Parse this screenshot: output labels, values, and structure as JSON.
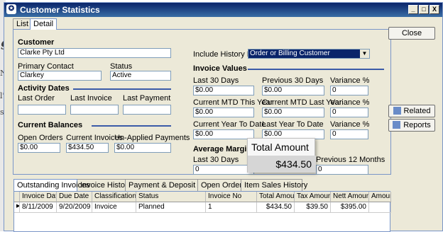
{
  "background": {
    "frag1": "g",
    "frag2": "Na",
    "frag3": "l's",
    "frag4": "sp"
  },
  "window": {
    "title": "Customer Statistics",
    "min": "_",
    "max": "□",
    "close": "X"
  },
  "tabs": [
    "List",
    "Detail"
  ],
  "customer": {
    "heading": "Customer",
    "name": "Clarke Pty Ltd",
    "primary_contact_label": "Primary Contact",
    "primary_contact": "Clarkey",
    "status_label": "Status",
    "status": "Active"
  },
  "history": {
    "label": "Include History For",
    "value": "Order or Billing Customer"
  },
  "activity": {
    "heading": "Activity Dates",
    "last_order": "Last Order",
    "last_invoice": "Last Invoice",
    "last_payment": "Last Payment"
  },
  "balances": {
    "heading": "Current Balances",
    "open_orders_label": "Open Orders",
    "open_orders": "$0.00",
    "current_invoices_label": "Current Invoices",
    "current_invoices": "$434.50",
    "unapplied_label": "Un-Applied Payments",
    "unapplied": "$0.00"
  },
  "invoice_values": {
    "heading": "Invoice Values",
    "last30_label": "Last 30 Days",
    "last30": "$0.00",
    "prev30_label": "Previous 30 Days",
    "prev30": "$0.00",
    "var_label": "Variance %",
    "var1": "0",
    "mtd_this_label": "Current MTD This Year",
    "mtd_this": "$0.00",
    "mtd_last_label": "Current MTD Last Year",
    "mtd_last": "$0.00",
    "var2": "0",
    "ytd_label": "Current Year To Date",
    "ytd": "$0.00",
    "lytd_label": "Last Year To Date",
    "lytd": "$0.00",
    "var3": "0"
  },
  "average": {
    "heading": "Average Margin",
    "last30_label": "Last 30 Days",
    "last30": "0",
    "prev12_label": "Previous 12 Months",
    "prev12": "0"
  },
  "tooltip": {
    "title": "Total Amount",
    "value": "$434.50"
  },
  "buttons": {
    "close": "Close",
    "related": "Related",
    "reports": "Reports"
  },
  "bottom_tabs": [
    "Outstanding Invoices",
    "Invoice History",
    "Payment & Deposit History",
    "Open Orders",
    "Item Sales History"
  ],
  "grid": {
    "columns": [
      "Invoice Date",
      "Due Date",
      "Classification",
      "Status",
      "Invoice No",
      "Total Amount",
      "Tax Amount",
      "Nett Amount",
      "Amour"
    ],
    "rows": [
      [
        "8/11/2009",
        "9/20/2009",
        "Invoice",
        "Planned",
        "1",
        "$434.50",
        "$39.50",
        "$395.00",
        ""
      ]
    ]
  }
}
